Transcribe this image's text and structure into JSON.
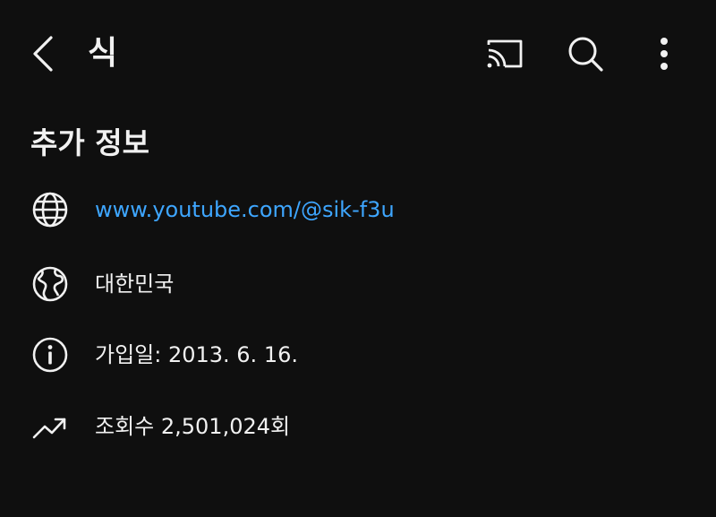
{
  "header": {
    "channel_name": "식"
  },
  "icons": {
    "back": "chevron-left-icon",
    "cast": "cast-icon",
    "search": "search-icon",
    "more": "more-vertical-icon",
    "link": "globe-icon",
    "country": "earth-icon",
    "joined": "info-icon",
    "views": "trending-up-icon"
  },
  "about": {
    "title": "추가 정보",
    "link": "www.youtube.com/@sik-f3u",
    "country": "대한민국",
    "joined": "가입일: 2013. 6. 16.",
    "views": "조회수 2,501,024회"
  },
  "colors": {
    "background": "#0f0f0f",
    "text": "#f1f1f1",
    "link": "#3ea6ff"
  }
}
